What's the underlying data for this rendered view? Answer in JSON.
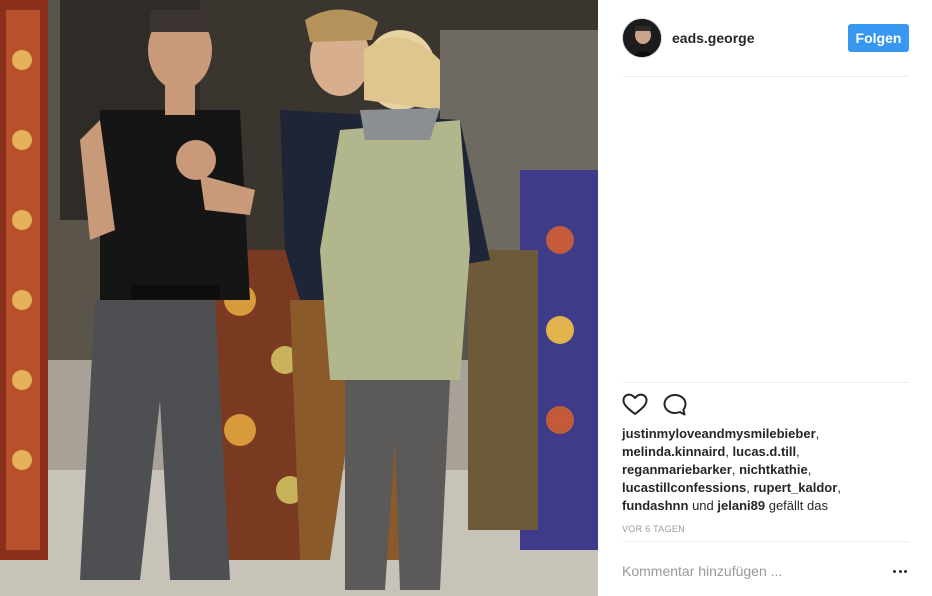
{
  "post": {
    "username": "eads.george",
    "follow_label": "Folgen",
    "likes_prefix_users": [
      "justinmyloveandmysmilebieber",
      "melinda.kinnaird",
      "lucas.d.till",
      "reganmariebarker",
      "nichtkathie",
      "lucastillconfessions",
      "rupert_kaldor",
      "fundashnn"
    ],
    "likes_conjunction": "und",
    "likes_last_user": "jelani89",
    "likes_suffix": "gefällt das",
    "timestamp": "VOR 6 TAGEN",
    "comment_placeholder": "Kommentar hinzufügen ...",
    "image_alt": ""
  },
  "icons": {
    "avatar": "profile-avatar",
    "like": "heart-icon",
    "comment": "comment-bubble-icon",
    "more": "more-options-icon"
  },
  "colors": {
    "accent": "#3897f0",
    "text": "#262626",
    "muted": "#999999",
    "divider": "#efefef"
  }
}
